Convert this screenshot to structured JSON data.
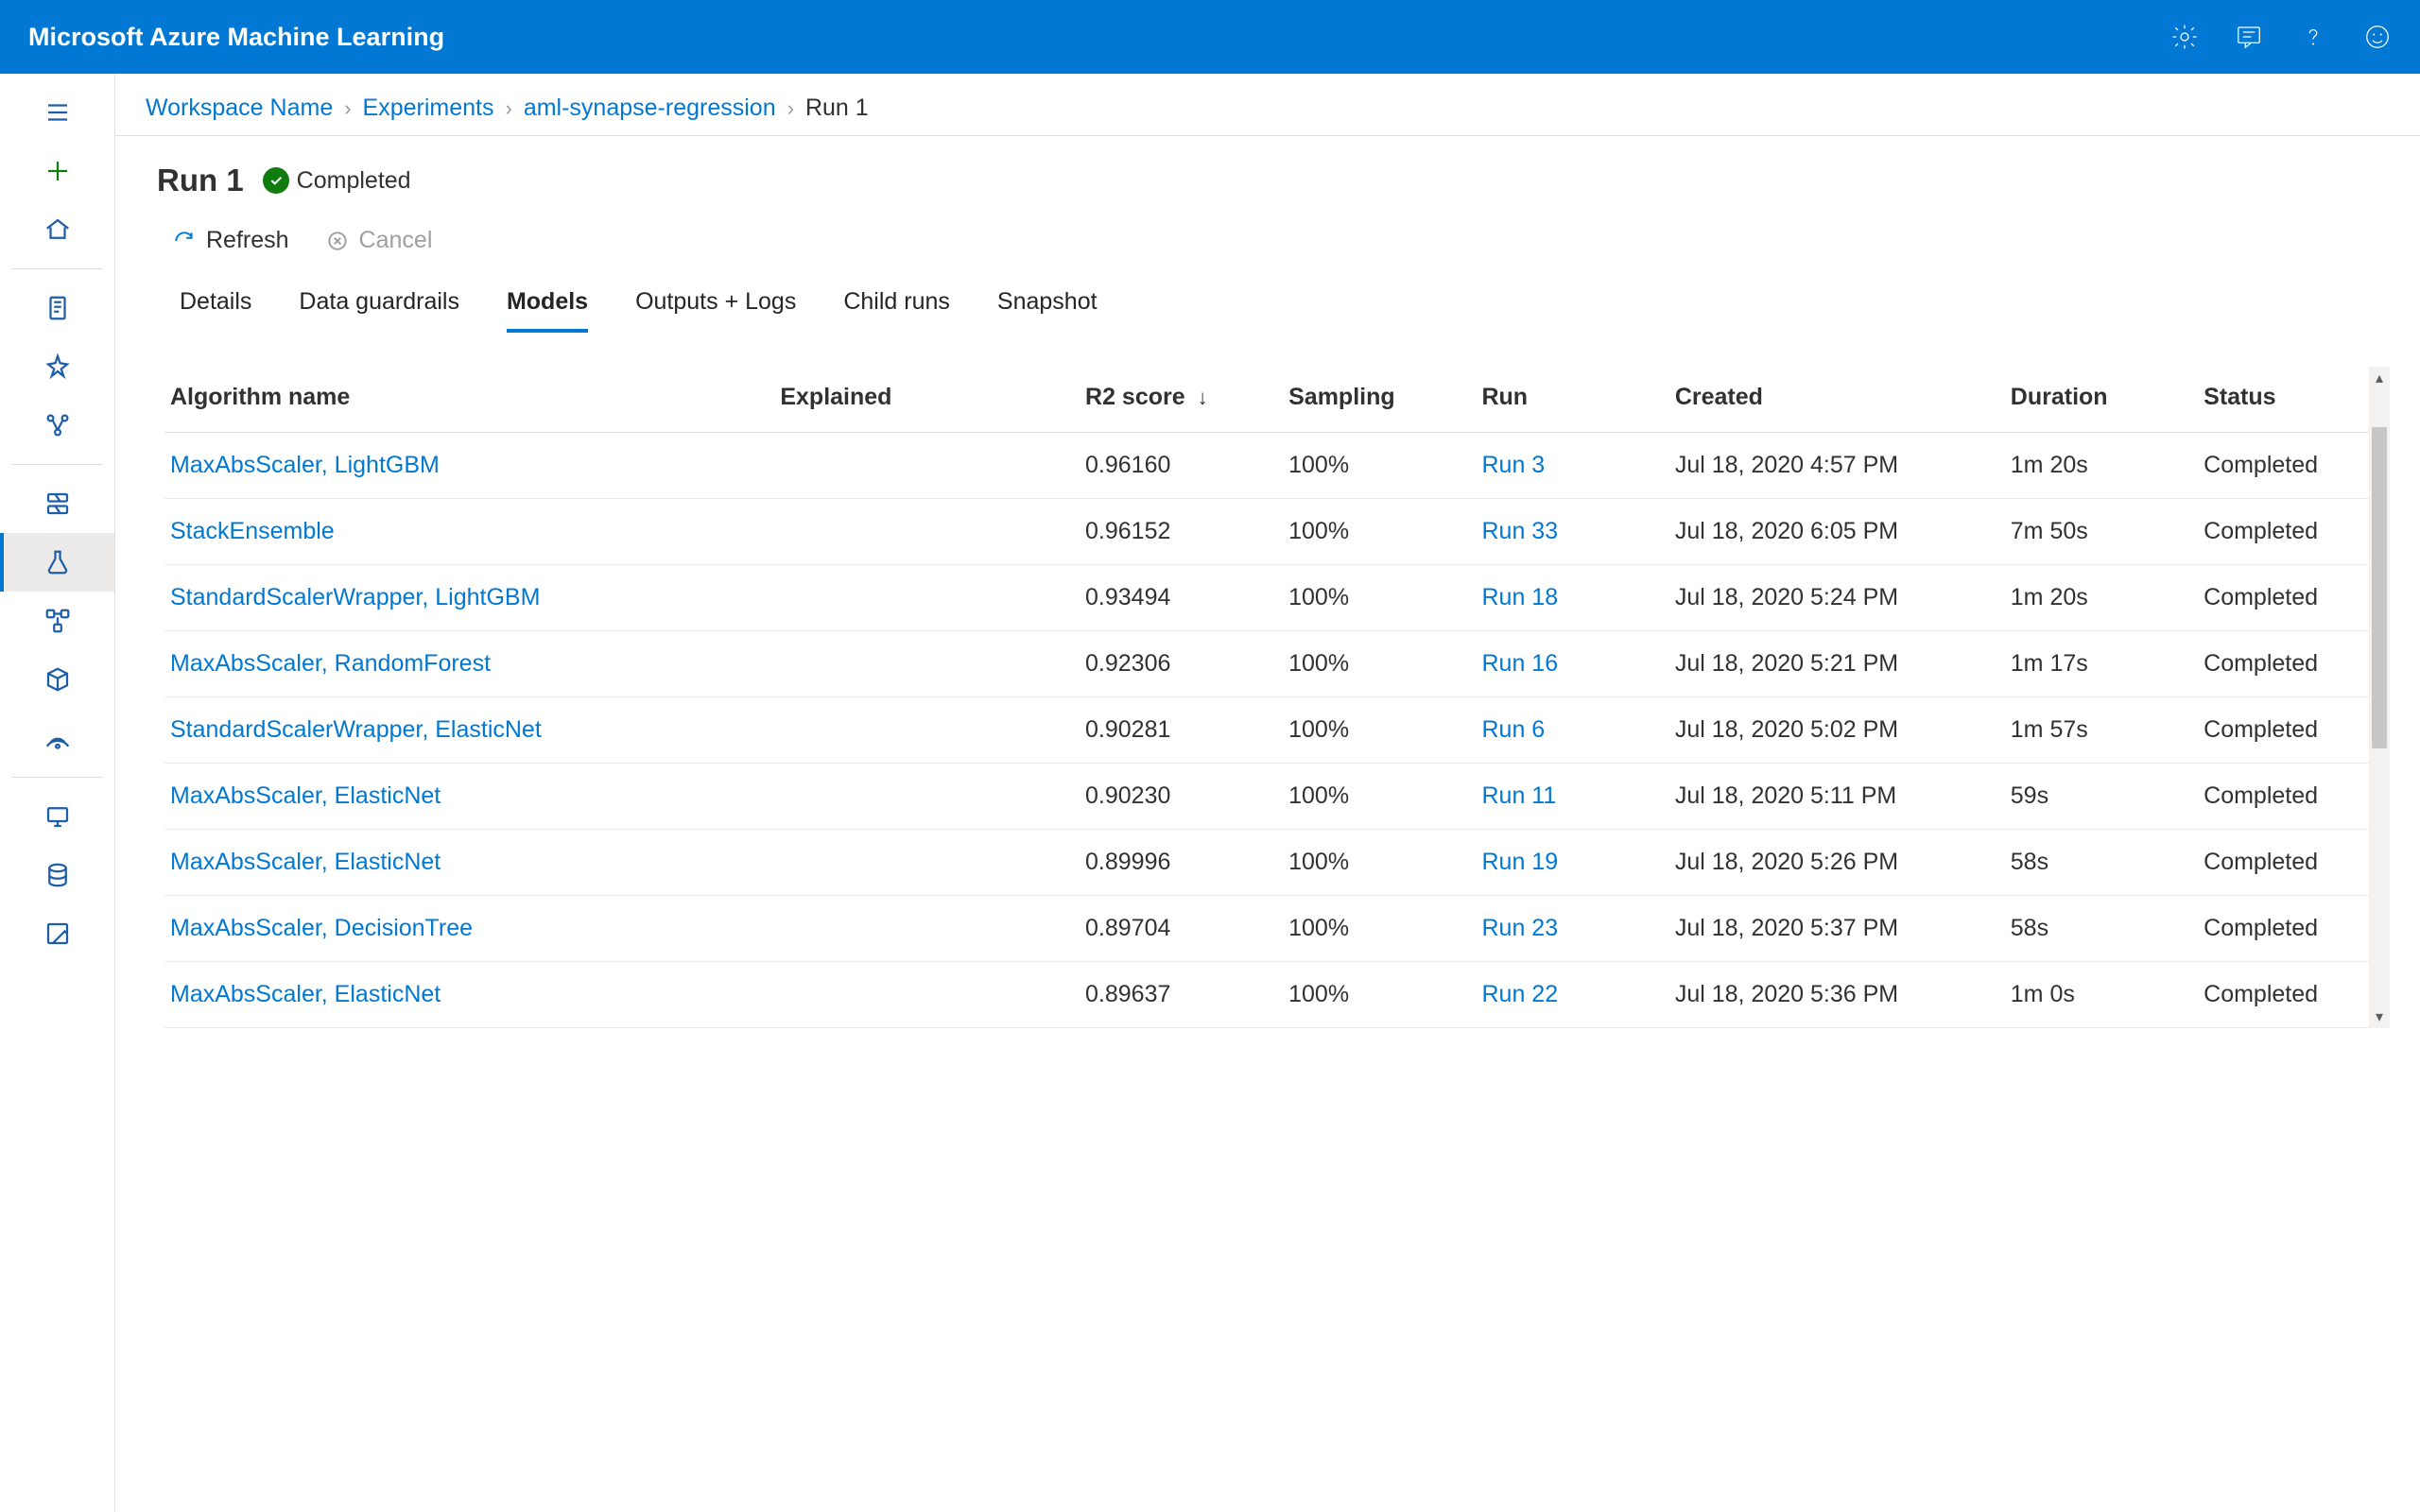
{
  "header": {
    "app_title": "Microsoft Azure Machine Learning"
  },
  "breadcrumb": {
    "workspace": "Workspace Name",
    "experiments": "Experiments",
    "experiment": "aml-synapse-regression",
    "run": "Run 1"
  },
  "page": {
    "title": "Run 1",
    "status_label": "Completed"
  },
  "actions": {
    "refresh": "Refresh",
    "cancel": "Cancel"
  },
  "tabs": {
    "details": "Details",
    "data_guardrails": "Data guardrails",
    "models": "Models",
    "outputs_logs": "Outputs + Logs",
    "child_runs": "Child runs",
    "snapshot": "Snapshot"
  },
  "table": {
    "columns": {
      "algorithm": "Algorithm name",
      "explained": "Explained",
      "r2": "R2 score",
      "sampling": "Sampling",
      "run": "Run",
      "created": "Created",
      "duration": "Duration",
      "status": "Status"
    },
    "rows": [
      {
        "algorithm": "MaxAbsScaler, LightGBM",
        "explained": "",
        "r2": "0.96160",
        "sampling": "100%",
        "run": "Run 3",
        "created": "Jul 18, 2020 4:57 PM",
        "duration": "1m 20s",
        "status": "Completed"
      },
      {
        "algorithm": "StackEnsemble",
        "explained": "",
        "r2": "0.96152",
        "sampling": "100%",
        "run": "Run 33",
        "created": "Jul 18, 2020 6:05 PM",
        "duration": "7m 50s",
        "status": "Completed"
      },
      {
        "algorithm": "StandardScalerWrapper, LightGBM",
        "explained": "",
        "r2": "0.93494",
        "sampling": "100%",
        "run": "Run 18",
        "created": "Jul 18, 2020 5:24 PM",
        "duration": "1m 20s",
        "status": "Completed"
      },
      {
        "algorithm": "MaxAbsScaler, RandomForest",
        "explained": "",
        "r2": "0.92306",
        "sampling": "100%",
        "run": "Run 16",
        "created": "Jul 18, 2020 5:21 PM",
        "duration": "1m 17s",
        "status": "Completed"
      },
      {
        "algorithm": "StandardScalerWrapper, ElasticNet",
        "explained": "",
        "r2": "0.90281",
        "sampling": "100%",
        "run": "Run 6",
        "created": "Jul 18, 2020 5:02 PM",
        "duration": "1m 57s",
        "status": "Completed"
      },
      {
        "algorithm": "MaxAbsScaler, ElasticNet",
        "explained": "",
        "r2": "0.90230",
        "sampling": "100%",
        "run": "Run 11",
        "created": "Jul 18, 2020 5:11 PM",
        "duration": "59s",
        "status": "Completed"
      },
      {
        "algorithm": "MaxAbsScaler, ElasticNet",
        "explained": "",
        "r2": "0.89996",
        "sampling": "100%",
        "run": "Run 19",
        "created": "Jul 18, 2020 5:26 PM",
        "duration": "58s",
        "status": "Completed"
      },
      {
        "algorithm": "MaxAbsScaler, DecisionTree",
        "explained": "",
        "r2": "0.89704",
        "sampling": "100%",
        "run": "Run 23",
        "created": "Jul 18, 2020 5:37 PM",
        "duration": "58s",
        "status": "Completed"
      },
      {
        "algorithm": "MaxAbsScaler, ElasticNet",
        "explained": "",
        "r2": "0.89637",
        "sampling": "100%",
        "run": "Run 22",
        "created": "Jul 18, 2020 5:36 PM",
        "duration": "1m 0s",
        "status": "Completed"
      }
    ]
  }
}
